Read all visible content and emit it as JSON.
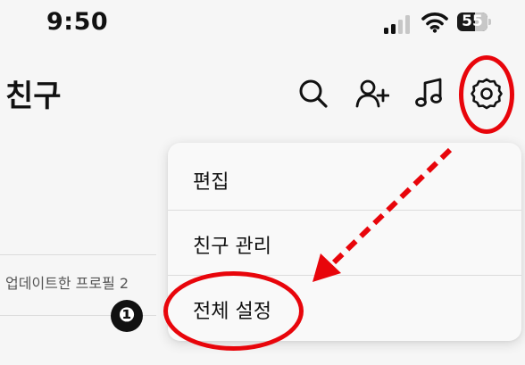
{
  "status_bar": {
    "time": "9:50",
    "battery_level": "55",
    "icons": [
      "signal-icon",
      "wifi-icon",
      "battery-icon"
    ]
  },
  "header": {
    "title": "친구",
    "icons": [
      "search-icon",
      "add-friend-icon",
      "music-icon",
      "settings-gear-icon"
    ]
  },
  "background": {
    "section_label": "업데이트한 프로필 2"
  },
  "dropdown_menu": {
    "items": [
      {
        "label": "편집"
      },
      {
        "label": "친구 관리"
      },
      {
        "label": "전체 설정"
      }
    ]
  },
  "annotation": {
    "step_number": "❶",
    "highlight_color": "#e8050b"
  }
}
